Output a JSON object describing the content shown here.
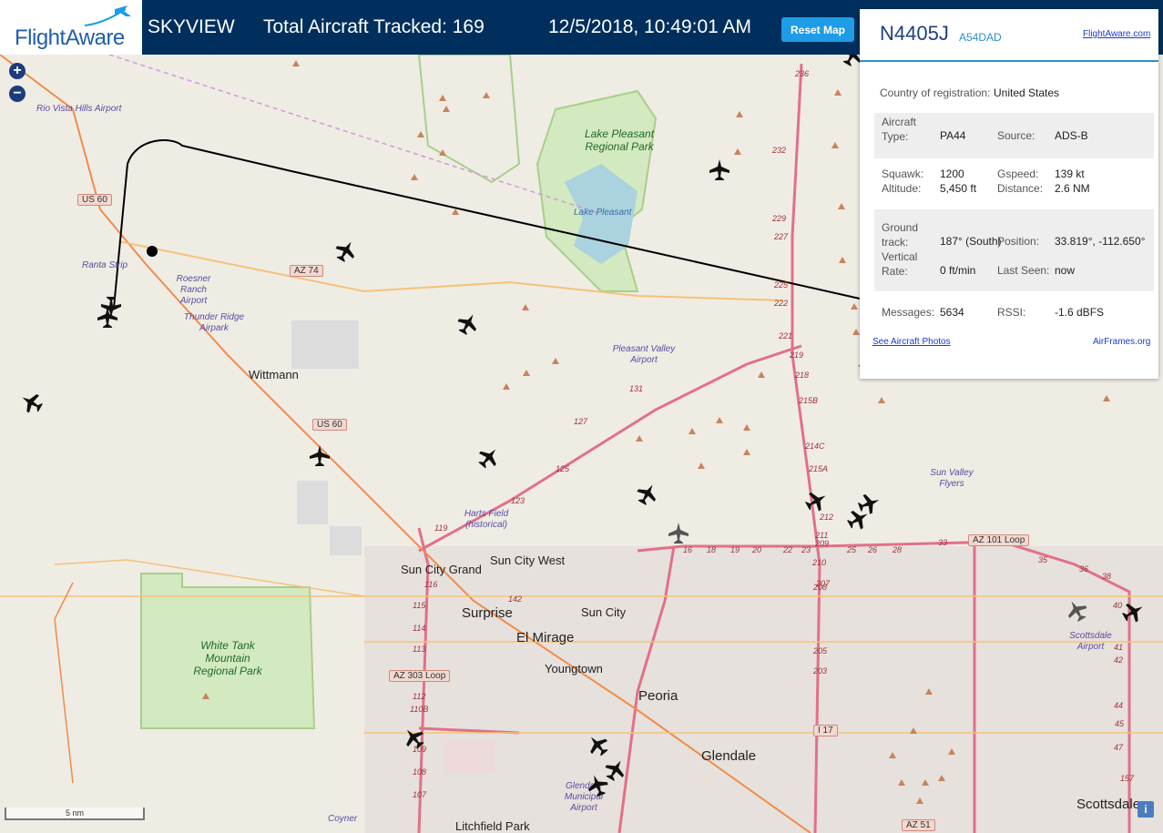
{
  "header": {
    "logo_text": "FlightAware",
    "app_name": "SKYVIEW",
    "tracked": "Total Aircraft Tracked: 169",
    "datetime": "12/5/2018, 10:49:01 AM",
    "reset_label": "Reset Map"
  },
  "map": {
    "zoom_in": "+",
    "zoom_out": "−",
    "scale_label": "5 nm",
    "info_label": "i",
    "colors": {
      "land": "#efece4",
      "park": "#c9e6b0",
      "water": "#a9d3df",
      "highway": "#e2708a",
      "road": "#f5c27a",
      "track": "#000000"
    },
    "towns": [
      "Wittmann",
      "Sun City West",
      "Sun City Grand",
      "Sun City",
      "Youngtown"
    ],
    "cities": [
      "Surprise",
      "El Mirage",
      "Peoria",
      "Glendale",
      "Scottsdale",
      "Litchfield Park"
    ],
    "airports": [
      "Rio Vista Hills Airport",
      "Ranta Strip",
      "Roesner Ranch Airport",
      "Thunder Ridge Airpark",
      "Pleasant Valley Airport",
      "Harts Field (historical)",
      "Sun Valley Flyers",
      "Scottsdale Airport",
      "Glendale Municipal Airport",
      "Coyner"
    ],
    "parks": [
      "Lake Pleasant Regional Park",
      "White Tank Mountain Regional Park"
    ],
    "water": "Lake Pleasant",
    "road_shields": [
      "US 60",
      "AZ 74",
      "US 60",
      "AZ 303 Loop",
      "AZ 101 Loop",
      "I 17",
      "AZ 51"
    ],
    "exits": [
      "236",
      "232",
      "229",
      "227",
      "225",
      "222",
      "221",
      "219",
      "218",
      "215B",
      "214C",
      "215A",
      "212",
      "211",
      "210",
      "209",
      "208",
      "207",
      "205",
      "203",
      "131",
      "127",
      "125",
      "123",
      "119",
      "116",
      "115",
      "114",
      "113",
      "112",
      "110B",
      "109",
      "108",
      "107",
      "142",
      "16",
      "18",
      "19",
      "20",
      "22",
      "23",
      "25",
      "26",
      "28",
      "33",
      "35",
      "36",
      "38",
      "40",
      "41",
      "42",
      "44",
      "45",
      "47",
      "157"
    ],
    "aircraft_count_on_map": 22
  },
  "panel": {
    "registration": "N4405J",
    "hex": "A54DAD",
    "fa_link": "FlightAware.com",
    "country_label": "Country of registration:",
    "country": "United States",
    "type_label": "Aircraft Type:",
    "type": "PA44",
    "source_label": "Source:",
    "source": "ADS-B",
    "squawk_label": "Squawk:",
    "squawk": "1200",
    "gspeed_label": "Gspeed:",
    "gspeed": "139 kt",
    "altitude_label": "Altitude:",
    "altitude": "5,450 ft",
    "distance_label": "Distance:",
    "distance": "2.6 NM",
    "track_label": "Ground track:",
    "track": "187° (South)",
    "position_label": "Position:",
    "position": "33.819°, -112.650°",
    "vrate_label": "Vertical Rate:",
    "vrate": "0 ft/min",
    "lastseen_label": "Last Seen:",
    "lastseen": "now",
    "messages_label": "Messages:",
    "messages": "5634",
    "rssi_label": "RSSI:",
    "rssi": "-1.6 dBFS",
    "photos_link": "See Aircraft Photos",
    "airframes_link": "AirFrames.org"
  }
}
